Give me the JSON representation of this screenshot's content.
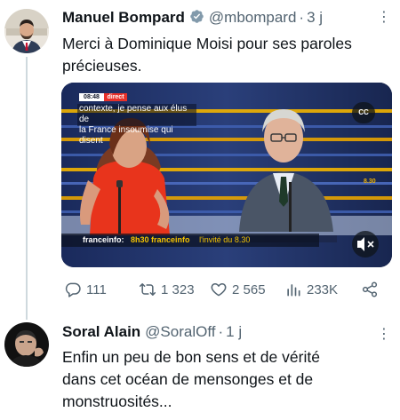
{
  "tweet1": {
    "name": "Manuel Bompard",
    "handle": "@mbompard",
    "separator": "·",
    "time": "3 j",
    "more": "⋮",
    "text_line1": "Merci à Dominique Moisi pour ses paroles",
    "text_line2": "précieuses.",
    "video": {
      "time_badge": "08:48",
      "live_badge": "direct",
      "caption_line1": "contexte, je pense aux élus de",
      "caption_line2": "la France insoumise qui disent",
      "cc_label": "CC",
      "ticker_brand": "franceinfo:",
      "ticker_text1": "8h30 franceinfo",
      "ticker_text2": "l'invité du 8.30",
      "backdrop_text": "8.30"
    },
    "actions": {
      "replies": "111",
      "retweets": "1 323",
      "likes": "2 565",
      "views": "233K"
    }
  },
  "tweet2": {
    "name": "Soral Alain",
    "handle": "@SoralOff",
    "separator": "·",
    "time": "1 j",
    "more": "⋮",
    "text_line1": "Enfin un peu de bon sens et de vérité",
    "text_line2": "dans cet océan de mensonges et de",
    "text_line3": "monstruosités..."
  },
  "colors": {
    "verified": "#829aab",
    "muted": "#536471",
    "thread_line": "#cfd9de",
    "franceinfo_yellow": "#f5c400",
    "live_red": "#e8312a"
  }
}
